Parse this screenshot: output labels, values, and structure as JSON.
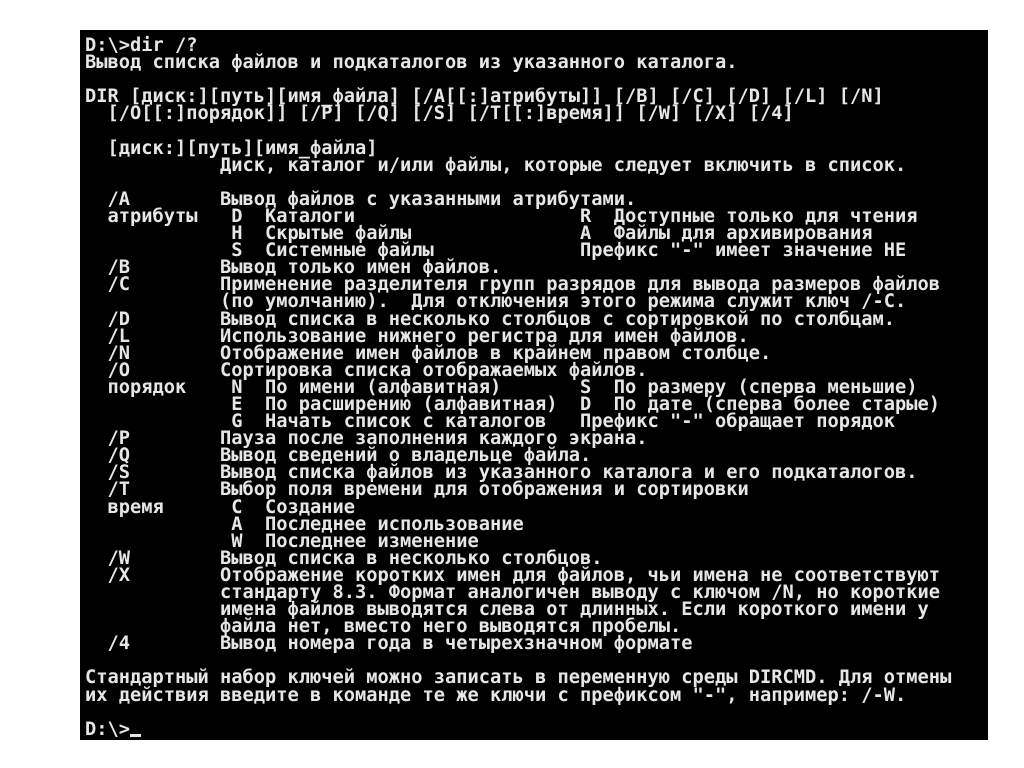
{
  "console": {
    "lines": [
      "D:\\>dir /?",
      "Вывод списка файлов и подкаталогов из указанного каталога.",
      "",
      "DIR [диск:][путь][имя_файла] [/A[[:]атрибуты]] [/B] [/C] [/D] [/L] [/N]",
      "  [/O[[:]порядок]] [/P] [/Q] [/S] [/T[[:]время]] [/W] [/X] [/4]",
      "",
      "  [диск:][путь][имя_файла]",
      "            Диск, каталог и/или файлы, которые следует включить в список.",
      "",
      "  /A        Вывод файлов с указанными атрибутами.",
      "  атрибуты   D  Каталоги                    R  Доступные только для чтения",
      "             H  Скрытые файлы               A  Файлы для архивирования",
      "             S  Системные файлы             Префикс \"-\" имеет значение НЕ",
      "  /B        Вывод только имен файлов.",
      "  /C        Применение разделителя групп разрядов для вывода размеров файлов",
      "            (по умолчанию).  Для отключения этого режима служит ключ /-C.",
      "  /D        Вывод списка в несколько столбцов с сортировкой по столбцам.",
      "  /L        Использование нижнего регистра для имен файлов.",
      "  /N        Отображение имен файлов в крайнем правом столбце.",
      "  /O        Сортировка списка отображаемых файлов.",
      "  порядок    N  По имени (алфавитная)       S  По размеру (сперва меньшие)",
      "             E  По расширению (алфавитная)  D  По дате (сперва более старые)",
      "             G  Начать список с каталогов   Префикс \"-\" обращает порядок",
      "  /P        Пауза после заполнения каждого экрана.",
      "  /Q        Вывод сведений о владельце файла.",
      "  /S        Вывод списка файлов из указанного каталога и его подкаталогов.",
      "  /T        Выбор поля времени для отображения и сортировки",
      "  время      C  Создание",
      "             A  Последнее использование",
      "             W  Последнее изменение",
      "  /W        Вывод списка в несколько столбцов.",
      "  /X        Отображение коротких имен для файлов, чьи имена не соответствуют",
      "            стандарту 8.3. Формат аналогичен выводу с ключом /N, но короткие",
      "            имена файлов выводятся слева от длинных. Если короткого имени у",
      "            файла нет, вместо него выводятся пробелы.",
      "  /4        Вывод номера года в четырехзначном формате",
      "",
      "Стандартный набор ключей можно записать в переменную среды DIRCMD. Для отмены",
      "их действия введите в команде те же ключи с префиксом \"-\", например: /-W.",
      ""
    ],
    "prompt": "D:\\>"
  },
  "colors": {
    "background": "#000000",
    "text": "#e6e6e6",
    "frame": "#ffffff"
  }
}
